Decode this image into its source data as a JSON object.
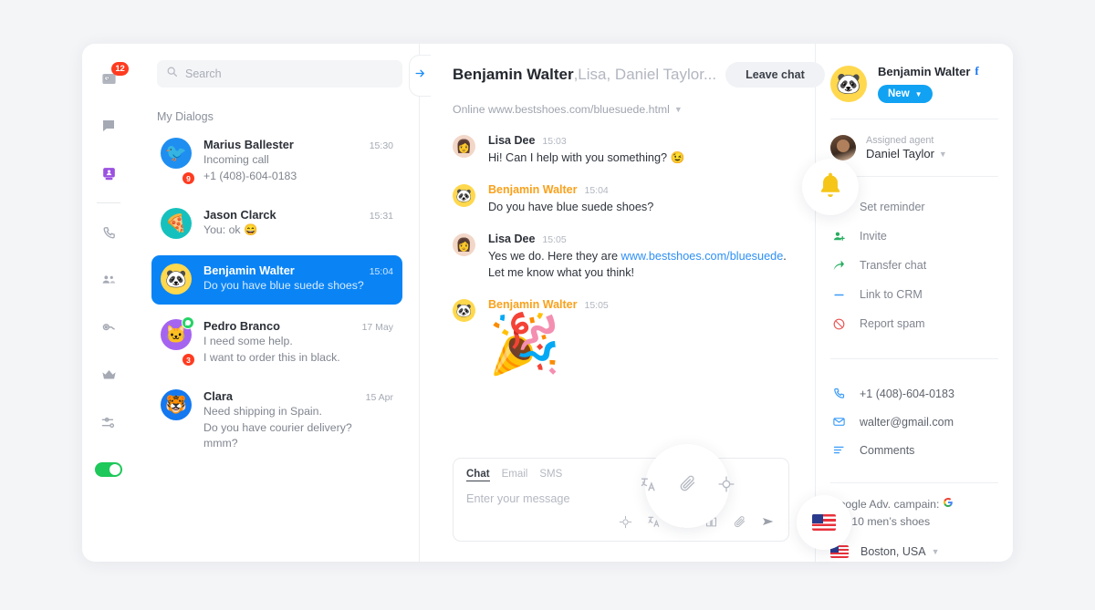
{
  "theme": {
    "page_bg": "#f4f5f7",
    "accent_blue": "#0a84f5",
    "orange": "#f9a11b",
    "green": "#1ec85a",
    "red_badge": "#ff3b20",
    "purple": "#9b51e0"
  },
  "rail": {
    "items": [
      {
        "name": "inbox-icon",
        "badge": "12"
      },
      {
        "name": "chat-icon",
        "badge": ""
      },
      {
        "name": "contact-card-icon",
        "badge": "",
        "active": true
      },
      {
        "name": "phone-icon",
        "badge": ""
      },
      {
        "name": "team-icon",
        "badge": ""
      },
      {
        "name": "bot-icon",
        "badge": ""
      },
      {
        "name": "crown-icon",
        "badge": ""
      },
      {
        "name": "settings-sliders-icon",
        "badge": ""
      }
    ],
    "toggle_on": true
  },
  "search": {
    "placeholder": "Search",
    "value": ""
  },
  "dialogs": {
    "title": "My Dialogs",
    "items": [
      {
        "name": "Marius Ballester",
        "time": "15:30",
        "lines": [
          "Incoming call",
          "+1 (408)-604-0183"
        ],
        "avatar_emoji": "🐦",
        "avatar_bg": "#1f8ef1",
        "unread": "9",
        "channel": "",
        "selected": false
      },
      {
        "name": "Jason Clarck",
        "time": "15:31",
        "lines": [
          "You: ok 😄"
        ],
        "avatar_emoji": "🍕",
        "avatar_bg": "#16c1bd",
        "unread": "",
        "channel": "",
        "selected": false
      },
      {
        "name": "Benjamin Walter",
        "time": "15:04",
        "lines": [
          "Do you have blue suede shoes?"
        ],
        "avatar_emoji": "🐼",
        "avatar_bg": "#ffd84d",
        "unread": "",
        "channel": "",
        "selected": true
      },
      {
        "name": "Pedro Branco",
        "time": "17 May",
        "lines": [
          "I need some help.",
          "I want to order this in black."
        ],
        "avatar_emoji": "🐱",
        "avatar_bg": "#a564f0",
        "unread": "3",
        "channel": "whatsapp",
        "selected": false
      },
      {
        "name": "Clara",
        "time": "15 Apr",
        "lines": [
          "Need shipping in Spain.",
          "Do you have courier delivery?",
          "mmm?"
        ],
        "avatar_emoji": "🐯",
        "avatar_bg": "#1478f0",
        "unread": "",
        "channel": "",
        "selected": false
      }
    ]
  },
  "chat": {
    "back_icon": "arrow-right-icon",
    "title_main": "Benjamin Walter",
    "title_rest": ",Lisa, Daniel Taylor...",
    "leave_label": "Leave chat",
    "status_line": "Online www.bestshoes.com/bluesuede.html",
    "messages": [
      {
        "author": "Lisa Dee",
        "time": "15:03",
        "is_customer": false,
        "avatar_emoji": "👩",
        "avatar_bg": "#f2d7c8",
        "text": "Hi! Can I help with you something? 😉",
        "link": "",
        "link_tail": "",
        "second_line": "",
        "emoji": ""
      },
      {
        "author": "Benjamin Walter",
        "time": "15:04",
        "is_customer": true,
        "avatar_emoji": "🐼",
        "avatar_bg": "#ffd84d",
        "text": "Do you have blue suede shoes?",
        "link": "",
        "link_tail": "",
        "second_line": "",
        "emoji": ""
      },
      {
        "author": "Lisa Dee",
        "time": "15:05",
        "is_customer": false,
        "avatar_emoji": "👩",
        "avatar_bg": "#f2d7c8",
        "text": "Yes we do. Here they are ",
        "link": "www.bestshoes.com/bluesuede",
        "link_tail": ".",
        "second_line": "Let me know what you think!",
        "emoji": ""
      },
      {
        "author": "Benjamin Walter",
        "time": "15:05",
        "is_customer": true,
        "avatar_emoji": "🐼",
        "avatar_bg": "#ffd84d",
        "text": "",
        "link": "",
        "link_tail": "",
        "second_line": "",
        "emoji": "🎉"
      }
    ]
  },
  "composer": {
    "tabs": [
      {
        "label": "Chat",
        "active": true
      },
      {
        "label": "Email",
        "active": false
      },
      {
        "label": "SMS",
        "active": false
      }
    ],
    "placeholder": "Enter your message",
    "value": "",
    "tools": [
      "target-icon",
      "translate-icon",
      "emoji-icon",
      "knowledge-icon",
      "attachment-icon",
      "send-icon"
    ]
  },
  "info": {
    "contact_name": "Benjamin Walter",
    "contact_channel_icon": "facebook-icon",
    "avatar_emoji": "🐼",
    "status_label": "New",
    "agent_label": "Assigned agent",
    "agent_name": "Daniel Taylor",
    "actions": [
      {
        "label": "Set reminder",
        "icon": "bell-icon",
        "color": "#f5c518"
      },
      {
        "label": "Invite",
        "icon": "user-add-icon",
        "color": "#27ae60"
      },
      {
        "label": "Transfer chat",
        "icon": "transfer-arrow-icon",
        "color": "#27ae60"
      },
      {
        "label": "Link to CRM",
        "icon": "link-icon",
        "color": "#3b9cf7"
      },
      {
        "label": "Report spam",
        "icon": "block-icon",
        "color": "#eb5757"
      }
    ],
    "contacts": [
      {
        "label": "+1 (408)-604-0183",
        "icon": "phone-icon"
      },
      {
        "label": "walter@gmail.com",
        "icon": "mail-icon"
      },
      {
        "label": "Comments",
        "icon": "comments-icon"
      }
    ],
    "campaign_label": "Google Adv. campain:",
    "campaign_icon": "google-icon",
    "campaign_value": "Top 10 men’s shoes",
    "location": "Boston, USA",
    "location_flag": "us-flag-icon"
  }
}
